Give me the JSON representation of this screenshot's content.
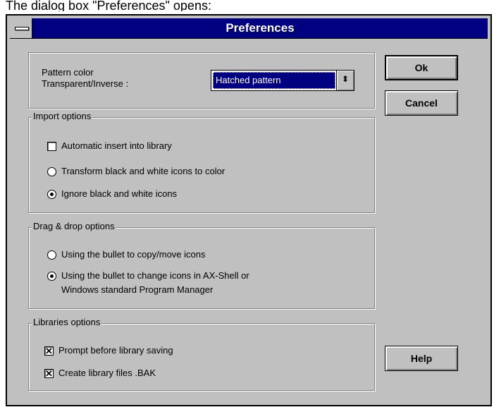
{
  "caption": "The dialog box \"Preferences\" opens:",
  "window": {
    "title": "Preferences"
  },
  "pattern": {
    "label_line1": "Pattern color",
    "label_line2": "Transparent/Inverse :",
    "selected": "Hatched pattern"
  },
  "import_options": {
    "title": "Import options",
    "auto_insert": {
      "label": "Automatic insert into library",
      "checked": false
    },
    "transform": {
      "label": "Transform black and white icons to color",
      "selected": false
    },
    "ignore": {
      "label": "Ignore black and white icons",
      "selected": true
    }
  },
  "drag_drop": {
    "title": "Drag & drop options",
    "copy_move": {
      "label": "Using the bullet to copy/move icons",
      "selected": false
    },
    "change_line1": "Using the bullet to change icons in AX-Shell or",
    "change_line2": "Windows standard Program Manager",
    "change_selected": true
  },
  "libraries": {
    "title": "Libraries options",
    "prompt": {
      "label": "Prompt before library saving",
      "checked": true
    },
    "bak": {
      "label": "Create library files .BAK",
      "checked": true
    }
  },
  "buttons": {
    "ok": "Ok",
    "cancel": "Cancel",
    "help": "Help"
  },
  "icons": {
    "system_menu": "system-menu-icon",
    "dropdown": "dropdown-arrow-icon",
    "check": "✕"
  }
}
